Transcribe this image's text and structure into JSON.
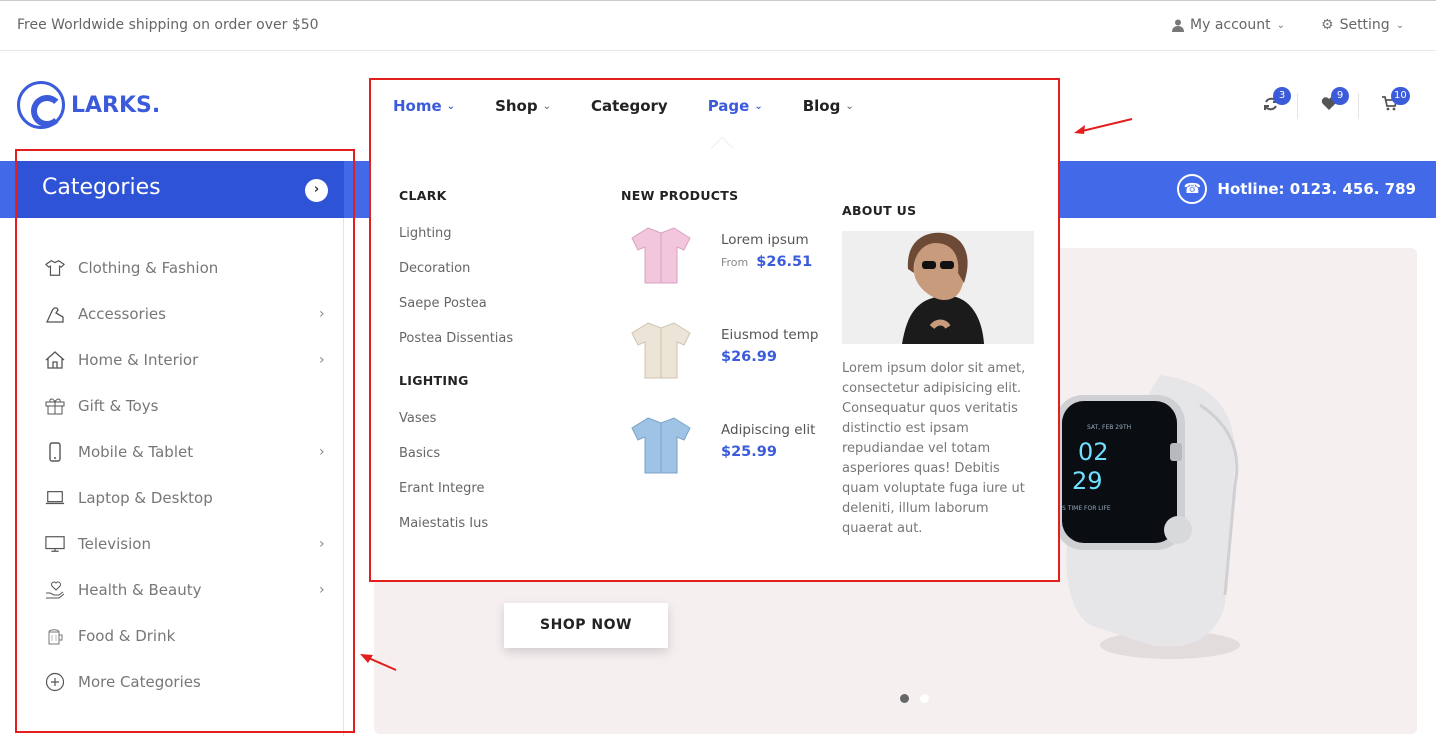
{
  "topbar": {
    "shipping": "Free Worldwide shipping on order over $50",
    "account": "My account",
    "setting": "Setting"
  },
  "logo": {
    "text": "LARKS."
  },
  "header": {
    "badges": {
      "compare": "3",
      "wishlist": "9",
      "cart": "10"
    }
  },
  "hotline": "Hotline: 0123. 456. 789",
  "nav": {
    "items": [
      "Home",
      "Shop",
      "Category",
      "Page",
      "Blog"
    ]
  },
  "categories": {
    "title": "Categories",
    "items": [
      {
        "label": "Clothing & Fashion",
        "icon": "shirt-icon"
      },
      {
        "label": "Accessories",
        "icon": "shoe-icon"
      },
      {
        "label": "Home & Interior",
        "icon": "house-icon"
      },
      {
        "label": "Gift & Toys",
        "icon": "gift-icon"
      },
      {
        "label": "Mobile & Tablet",
        "icon": "phone-icon"
      },
      {
        "label": "Laptop & Desktop",
        "icon": "laptop-icon"
      },
      {
        "label": "Television",
        "icon": "tv-icon"
      },
      {
        "label": "Health & Beauty",
        "icon": "heart-hand-icon"
      },
      {
        "label": "Food & Drink",
        "icon": "drink-icon"
      },
      {
        "label": "More Categories",
        "icon": "plus-circle-icon"
      }
    ]
  },
  "mega": {
    "clark": {
      "title": "CLARK",
      "links": [
        "Lighting",
        "Decoration",
        "Saepe Postea",
        "Postea Dissentias"
      ]
    },
    "lighting": {
      "title": "LIGHTING",
      "links": [
        "Vases",
        "Basics",
        "Erant Integre",
        "Maiestatis Ius"
      ]
    },
    "new_products": {
      "title": "NEW PRODUCTS",
      "items": [
        {
          "name": "Lorem ipsum",
          "from": "From",
          "price": "$26.51",
          "color": "#f2c6dc"
        },
        {
          "name": "Eiusmod temp",
          "price": "$26.99",
          "color": "#ece4d6"
        },
        {
          "name": "Adipiscing elit",
          "price": "$25.99",
          "color": "#9ec3e4"
        }
      ]
    },
    "about": {
      "title": "ABOUT US",
      "text": "Lorem ipsum dolor sit amet, consectetur adipisicing elit. Consequatur quos veritatis distinctio est ipsam repudiandae vel totam asperiores quas! Debitis quam voluptate fuga iure ut deleniti, illum laborum quaerat aut."
    }
  },
  "hero": {
    "button": "SHOP NOW",
    "watch": {
      "date": "SAT, FEB 29TH",
      "hour": "02",
      "minute": "29",
      "caption": "S TIME FOR LIFE"
    }
  },
  "colors": {
    "accent": "#3b5bdb",
    "bar": "#4169e8",
    "category_header": "#2f53d6",
    "annotation": "#e41d1d"
  }
}
